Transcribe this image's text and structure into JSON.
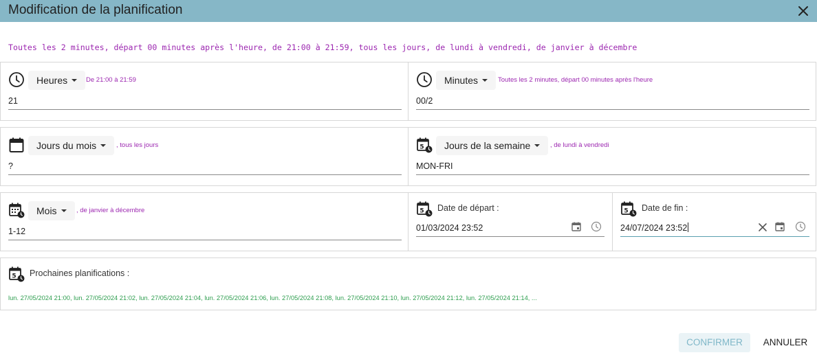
{
  "dialog": {
    "title": "Modification de la planification",
    "close_icon": "close-icon"
  },
  "summary": "Toutes les 2 minutes, départ 00 minutes après l'heure, de 21:00 à 21:59, tous les jours, de lundi à vendredi, de janvier à décembre",
  "hours": {
    "icon": "clock-icon",
    "label": "Heures",
    "description": "De 21:00 à 21:59",
    "value": "21"
  },
  "minutes": {
    "icon": "clock-icon",
    "label": "Minutes",
    "description": "Toutes les 2 minutes, départ 00 minutes après l'heure",
    "value": "00/2"
  },
  "days_of_month": {
    "icon": "calendar-icon",
    "label": "Jours du mois",
    "description": ", tous les jours",
    "value": "?"
  },
  "days_of_week": {
    "icon": "calendar-week-clock-icon",
    "label": "Jours de la semaine",
    "description": ", de lundi à vendredi",
    "value": "MON-FRI"
  },
  "months": {
    "icon": "calendar-month-clock-icon",
    "label": "Mois",
    "description": ", de janvier à décembre",
    "value": "1-12"
  },
  "start_date": {
    "icon": "calendar-clock-icon",
    "label": "Date de départ :",
    "value": "01/03/2024 23:52"
  },
  "end_date": {
    "icon": "calendar-clock-icon",
    "label": "Date de fin :",
    "value": "24/07/2024 23:52"
  },
  "next": {
    "icon": "calendar-clock-icon",
    "label": "Prochaines planifications :",
    "list": "lun. 27/05/2024 21:00, lun. 27/05/2024 21:02, lun. 27/05/2024 21:04, lun. 27/05/2024 21:06, lun. 27/05/2024 21:08, lun. 27/05/2024 21:10, lun. 27/05/2024 21:12, lun. 27/05/2024 21:14, ..."
  },
  "actions": {
    "confirm": "CONFIRMER",
    "cancel": "ANNULER"
  },
  "colors": {
    "header": "#86b7c7",
    "description": "#9c27b0",
    "next_list": "#2e9e4f",
    "confirm_text": "#7fb7c8"
  }
}
